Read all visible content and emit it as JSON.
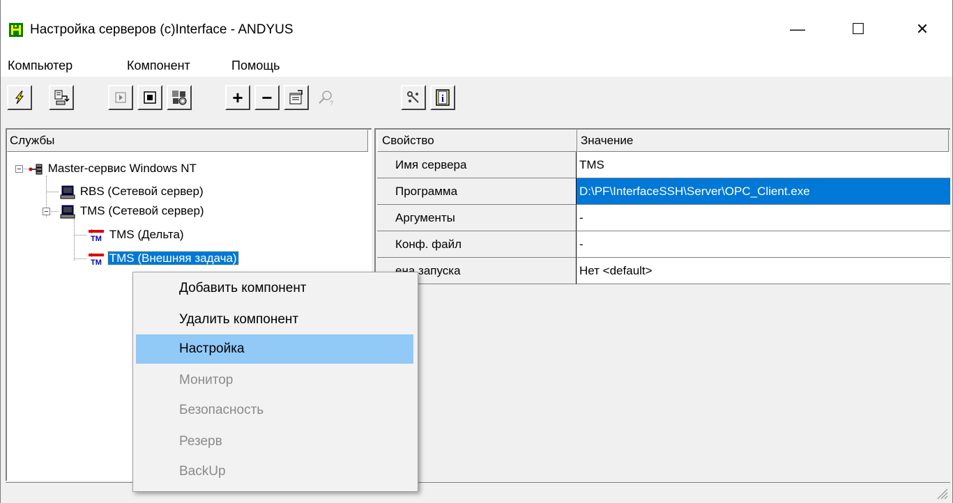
{
  "window": {
    "title": "Настройка серверов (c)Interface - ANDYUS",
    "minimize_glyph": "—",
    "maximize_glyph": "☐",
    "close_glyph": "✕"
  },
  "menubar": {
    "items": [
      "Компьютер",
      "Компонент",
      "Помощь"
    ]
  },
  "toolbar": {
    "buttons": [
      {
        "icon": "connect-icon"
      },
      {
        "icon": "export-icon"
      },
      {
        "icon": "start-icon"
      },
      {
        "icon": "stop-icon"
      },
      {
        "icon": "configure-icon"
      },
      {
        "icon": "add-icon",
        "glyph": "+"
      },
      {
        "icon": "remove-icon",
        "glyph": "−"
      },
      {
        "icon": "properties-icon"
      },
      {
        "icon": "find-icon"
      },
      {
        "icon": "tools-icon"
      },
      {
        "icon": "info-icon",
        "glyph": "i"
      }
    ]
  },
  "tree": {
    "header": "Службы",
    "nodes": [
      {
        "label": "Master-сервис Windows NT",
        "icon": "network-icon",
        "expander": "−"
      },
      {
        "label": "RBS (Сетевой сервер)",
        "icon": "computer-icon"
      },
      {
        "label": "TMS (Сетевой сервер)",
        "icon": "computer-icon",
        "expander": "−"
      },
      {
        "label": "TMS (Дельта)",
        "icon": "tm-icon",
        "icon_text": "TM"
      },
      {
        "label": "TMS (Внешняя задача)",
        "icon": "tm-icon",
        "icon_text": "TM",
        "selected": true
      }
    ]
  },
  "properties": {
    "header_property": "Свойство",
    "header_value": "Значение",
    "rows": [
      {
        "property": "Имя сервера",
        "value": "TMS"
      },
      {
        "property": "Программа",
        "value": "D:\\PF\\InterfaceSSH\\Server\\OPC_Client.exe",
        "selected": true
      },
      {
        "property": "Аргументы",
        "value": "-"
      },
      {
        "property": "Конф. файл",
        "value": "-"
      },
      {
        "property": "ена запуска",
        "value": "Нет <default>"
      }
    ]
  },
  "context_menu": {
    "items": [
      {
        "label": "Добавить компонент",
        "enabled": true
      },
      {
        "label": "Удалить компонент",
        "enabled": true
      },
      {
        "label": "Настройка",
        "enabled": true,
        "hover": true
      },
      {
        "label": "Монитор",
        "enabled": false
      },
      {
        "label": "Безопасность",
        "enabled": false
      },
      {
        "label": "Резерв",
        "enabled": false
      },
      {
        "label": "BackUp",
        "enabled": false
      }
    ]
  },
  "colors": {
    "selection": "#0078d7",
    "menu_hover": "#91c9f7",
    "disabled_text": "#8a8a8a",
    "tm_icon": "#e00000"
  }
}
